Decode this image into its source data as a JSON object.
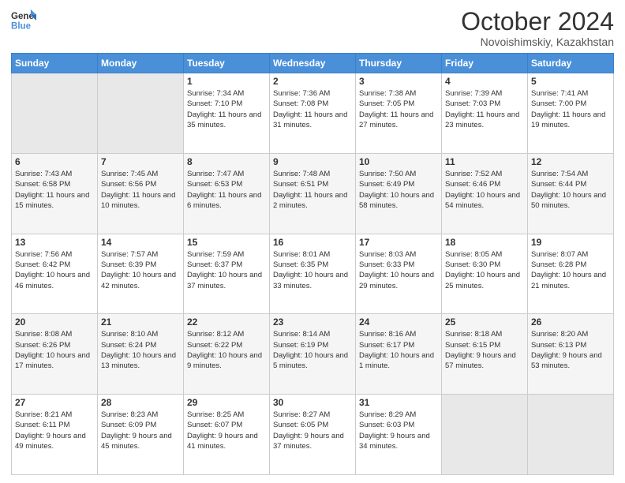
{
  "logo": {
    "line1": "General",
    "line2": "Blue"
  },
  "title": "October 2024",
  "subtitle": "Novoishimskiy, Kazakhstan",
  "days_of_week": [
    "Sunday",
    "Monday",
    "Tuesday",
    "Wednesday",
    "Thursday",
    "Friday",
    "Saturday"
  ],
  "weeks": [
    [
      {
        "day": "",
        "info": ""
      },
      {
        "day": "",
        "info": ""
      },
      {
        "day": "1",
        "info": "Sunrise: 7:34 AM\nSunset: 7:10 PM\nDaylight: 11 hours and 35 minutes."
      },
      {
        "day": "2",
        "info": "Sunrise: 7:36 AM\nSunset: 7:08 PM\nDaylight: 11 hours and 31 minutes."
      },
      {
        "day": "3",
        "info": "Sunrise: 7:38 AM\nSunset: 7:05 PM\nDaylight: 11 hours and 27 minutes."
      },
      {
        "day": "4",
        "info": "Sunrise: 7:39 AM\nSunset: 7:03 PM\nDaylight: 11 hours and 23 minutes."
      },
      {
        "day": "5",
        "info": "Sunrise: 7:41 AM\nSunset: 7:00 PM\nDaylight: 11 hours and 19 minutes."
      }
    ],
    [
      {
        "day": "6",
        "info": "Sunrise: 7:43 AM\nSunset: 6:58 PM\nDaylight: 11 hours and 15 minutes."
      },
      {
        "day": "7",
        "info": "Sunrise: 7:45 AM\nSunset: 6:56 PM\nDaylight: 11 hours and 10 minutes."
      },
      {
        "day": "8",
        "info": "Sunrise: 7:47 AM\nSunset: 6:53 PM\nDaylight: 11 hours and 6 minutes."
      },
      {
        "day": "9",
        "info": "Sunrise: 7:48 AM\nSunset: 6:51 PM\nDaylight: 11 hours and 2 minutes."
      },
      {
        "day": "10",
        "info": "Sunrise: 7:50 AM\nSunset: 6:49 PM\nDaylight: 10 hours and 58 minutes."
      },
      {
        "day": "11",
        "info": "Sunrise: 7:52 AM\nSunset: 6:46 PM\nDaylight: 10 hours and 54 minutes."
      },
      {
        "day": "12",
        "info": "Sunrise: 7:54 AM\nSunset: 6:44 PM\nDaylight: 10 hours and 50 minutes."
      }
    ],
    [
      {
        "day": "13",
        "info": "Sunrise: 7:56 AM\nSunset: 6:42 PM\nDaylight: 10 hours and 46 minutes."
      },
      {
        "day": "14",
        "info": "Sunrise: 7:57 AM\nSunset: 6:39 PM\nDaylight: 10 hours and 42 minutes."
      },
      {
        "day": "15",
        "info": "Sunrise: 7:59 AM\nSunset: 6:37 PM\nDaylight: 10 hours and 37 minutes."
      },
      {
        "day": "16",
        "info": "Sunrise: 8:01 AM\nSunset: 6:35 PM\nDaylight: 10 hours and 33 minutes."
      },
      {
        "day": "17",
        "info": "Sunrise: 8:03 AM\nSunset: 6:33 PM\nDaylight: 10 hours and 29 minutes."
      },
      {
        "day": "18",
        "info": "Sunrise: 8:05 AM\nSunset: 6:30 PM\nDaylight: 10 hours and 25 minutes."
      },
      {
        "day": "19",
        "info": "Sunrise: 8:07 AM\nSunset: 6:28 PM\nDaylight: 10 hours and 21 minutes."
      }
    ],
    [
      {
        "day": "20",
        "info": "Sunrise: 8:08 AM\nSunset: 6:26 PM\nDaylight: 10 hours and 17 minutes."
      },
      {
        "day": "21",
        "info": "Sunrise: 8:10 AM\nSunset: 6:24 PM\nDaylight: 10 hours and 13 minutes."
      },
      {
        "day": "22",
        "info": "Sunrise: 8:12 AM\nSunset: 6:22 PM\nDaylight: 10 hours and 9 minutes."
      },
      {
        "day": "23",
        "info": "Sunrise: 8:14 AM\nSunset: 6:19 PM\nDaylight: 10 hours and 5 minutes."
      },
      {
        "day": "24",
        "info": "Sunrise: 8:16 AM\nSunset: 6:17 PM\nDaylight: 10 hours and 1 minute."
      },
      {
        "day": "25",
        "info": "Sunrise: 8:18 AM\nSunset: 6:15 PM\nDaylight: 9 hours and 57 minutes."
      },
      {
        "day": "26",
        "info": "Sunrise: 8:20 AM\nSunset: 6:13 PM\nDaylight: 9 hours and 53 minutes."
      }
    ],
    [
      {
        "day": "27",
        "info": "Sunrise: 8:21 AM\nSunset: 6:11 PM\nDaylight: 9 hours and 49 minutes."
      },
      {
        "day": "28",
        "info": "Sunrise: 8:23 AM\nSunset: 6:09 PM\nDaylight: 9 hours and 45 minutes."
      },
      {
        "day": "29",
        "info": "Sunrise: 8:25 AM\nSunset: 6:07 PM\nDaylight: 9 hours and 41 minutes."
      },
      {
        "day": "30",
        "info": "Sunrise: 8:27 AM\nSunset: 6:05 PM\nDaylight: 9 hours and 37 minutes."
      },
      {
        "day": "31",
        "info": "Sunrise: 8:29 AM\nSunset: 6:03 PM\nDaylight: 9 hours and 34 minutes."
      },
      {
        "day": "",
        "info": ""
      },
      {
        "day": "",
        "info": ""
      }
    ]
  ]
}
